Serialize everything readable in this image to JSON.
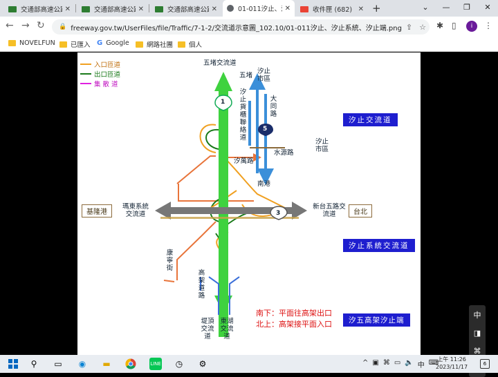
{
  "browser": {
    "tabs": [
      {
        "title": "交通部高速公路局",
        "icon": "gmail-icon"
      },
      {
        "title": "交通部高速公路局",
        "icon": "gmail-icon"
      },
      {
        "title": "交通部高速公路局",
        "icon": "gmail-icon"
      },
      {
        "title": "01-011汐止、汐止系統",
        "icon": "web-icon"
      },
      {
        "title": "收件匣 (682)",
        "icon": "gmail-icon"
      }
    ],
    "new_tab": "+",
    "url": "freeway.gov.tw/UserFiles/file/Traffic/7-1-2/交流道示意圖_102.10/01-011汐止、汐止系統、汐止端.png",
    "bookmarks": [
      "NOVELFUN",
      "已匯入",
      "Google",
      "網路社團",
      "個人"
    ],
    "profile_initial": "i"
  },
  "diagram": {
    "legend": [
      {
        "label": "入口匝道",
        "color": "#f0a020"
      },
      {
        "label": "出口匝道",
        "color": "#1a7a1a"
      },
      {
        "label": "集 散 道",
        "color": "#e020e0"
      }
    ],
    "labels": {
      "wudu": "五堵交流道",
      "wudu_short": "五堵",
      "xizhi_city_top": "汐止市區",
      "xizhi_cargo": "汐止貨櫃聯絡道",
      "datong": "大同路",
      "xizhi_city_right": "汐止市區",
      "shuiyuan": "水源路",
      "xikang": "汐萬路",
      "nangang": "南港",
      "keelung": "基隆港",
      "madong": "瑪東系統交流道",
      "xintai": "新台五路交流道",
      "taipei": "台北",
      "kangning": "康寧街",
      "elevated": "高架道路",
      "tiding": "堤頂交流道",
      "donghu": "東湖交流道",
      "shield_1": "1",
      "shield_3": "3",
      "shield_5": "5"
    },
    "blue_labels": [
      "汐止交流道",
      "汐止系統交流道",
      "汐五高架汐止端"
    ],
    "notes": [
      "南下：平面往高架出口",
      "北上：高架接平面入口"
    ]
  },
  "sidepanel": {
    "items": [
      "中",
      "◨",
      "⌘",
      "⚙"
    ]
  },
  "taskbar": {
    "ime": "中",
    "time": "上午 11:26",
    "date": "2023/11/17",
    "notifications": "6"
  }
}
